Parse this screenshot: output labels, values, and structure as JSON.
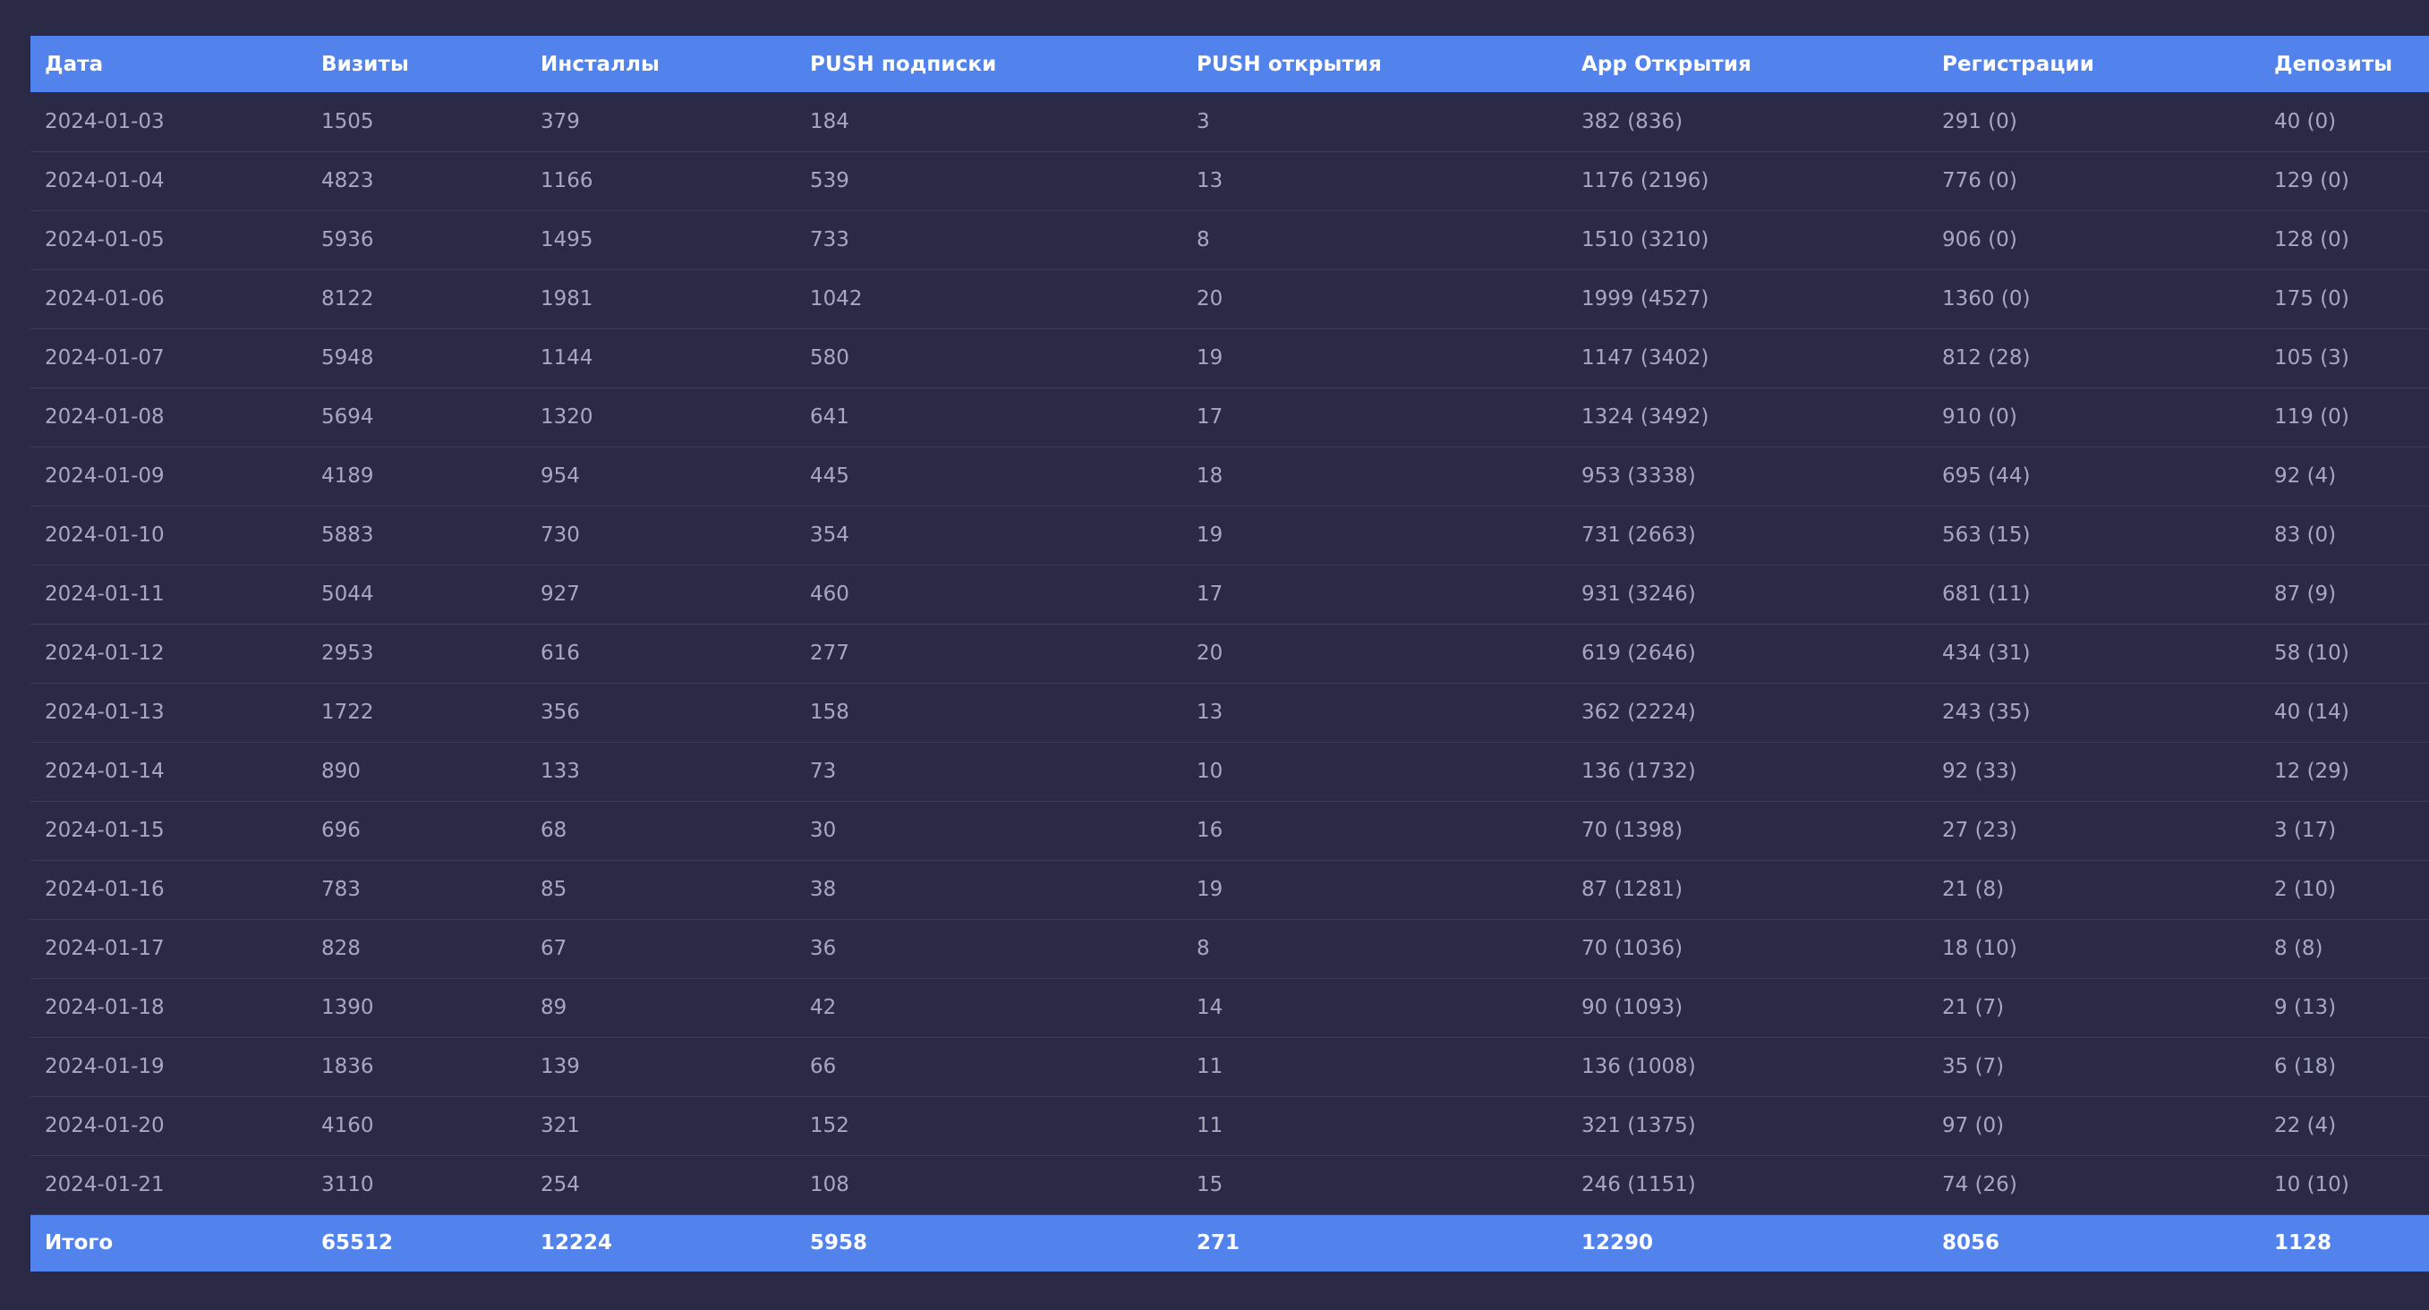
{
  "table": {
    "headers": [
      "Дата",
      "Визиты",
      "Инсталлы",
      "PUSH подписки",
      "PUSH открытия",
      "App Открытия",
      "Регистрации",
      "Депозиты"
    ],
    "rows": [
      [
        "2024-01-03",
        "1505",
        "379",
        "184",
        "3",
        "382 (836)",
        "291 (0)",
        "40 (0)"
      ],
      [
        "2024-01-04",
        "4823",
        "1166",
        "539",
        "13",
        "1176 (2196)",
        "776 (0)",
        "129 (0)"
      ],
      [
        "2024-01-05",
        "5936",
        "1495",
        "733",
        "8",
        "1510 (3210)",
        "906 (0)",
        "128 (0)"
      ],
      [
        "2024-01-06",
        "8122",
        "1981",
        "1042",
        "20",
        "1999 (4527)",
        "1360 (0)",
        "175 (0)"
      ],
      [
        "2024-01-07",
        "5948",
        "1144",
        "580",
        "19",
        "1147 (3402)",
        "812 (28)",
        "105 (3)"
      ],
      [
        "2024-01-08",
        "5694",
        "1320",
        "641",
        "17",
        "1324 (3492)",
        "910 (0)",
        "119 (0)"
      ],
      [
        "2024-01-09",
        "4189",
        "954",
        "445",
        "18",
        "953 (3338)",
        "695 (44)",
        "92 (4)"
      ],
      [
        "2024-01-10",
        "5883",
        "730",
        "354",
        "19",
        "731 (2663)",
        "563 (15)",
        "83 (0)"
      ],
      [
        "2024-01-11",
        "5044",
        "927",
        "460",
        "17",
        "931 (3246)",
        "681 (11)",
        "87 (9)"
      ],
      [
        "2024-01-12",
        "2953",
        "616",
        "277",
        "20",
        "619 (2646)",
        "434 (31)",
        "58 (10)"
      ],
      [
        "2024-01-13",
        "1722",
        "356",
        "158",
        "13",
        "362 (2224)",
        "243 (35)",
        "40 (14)"
      ],
      [
        "2024-01-14",
        "890",
        "133",
        "73",
        "10",
        "136 (1732)",
        "92 (33)",
        "12 (29)"
      ],
      [
        "2024-01-15",
        "696",
        "68",
        "30",
        "16",
        "70 (1398)",
        "27 (23)",
        "3 (17)"
      ],
      [
        "2024-01-16",
        "783",
        "85",
        "38",
        "19",
        "87 (1281)",
        "21 (8)",
        "2 (10)"
      ],
      [
        "2024-01-17",
        "828",
        "67",
        "36",
        "8",
        "70 (1036)",
        "18 (10)",
        "8 (8)"
      ],
      [
        "2024-01-18",
        "1390",
        "89",
        "42",
        "14",
        "90 (1093)",
        "21 (7)",
        "9 (13)"
      ],
      [
        "2024-01-19",
        "1836",
        "139",
        "66",
        "11",
        "136 (1008)",
        "35 (7)",
        "6 (18)"
      ],
      [
        "2024-01-20",
        "4160",
        "321",
        "152",
        "11",
        "321 (1375)",
        "97 (0)",
        "22 (4)"
      ],
      [
        "2024-01-21",
        "3110",
        "254",
        "108",
        "15",
        "246 (1151)",
        "74 (26)",
        "10 (10)"
      ]
    ],
    "totals": [
      "Итого",
      "65512",
      "12224",
      "5958",
      "271",
      "12290",
      "8056",
      "1128"
    ]
  },
  "colors": {
    "page_background": "#2a2a47",
    "header_background": "#5282ec",
    "row_divider": "#3c3c60",
    "cell_text": "#a6a8bf",
    "header_text": "#ffffff"
  }
}
